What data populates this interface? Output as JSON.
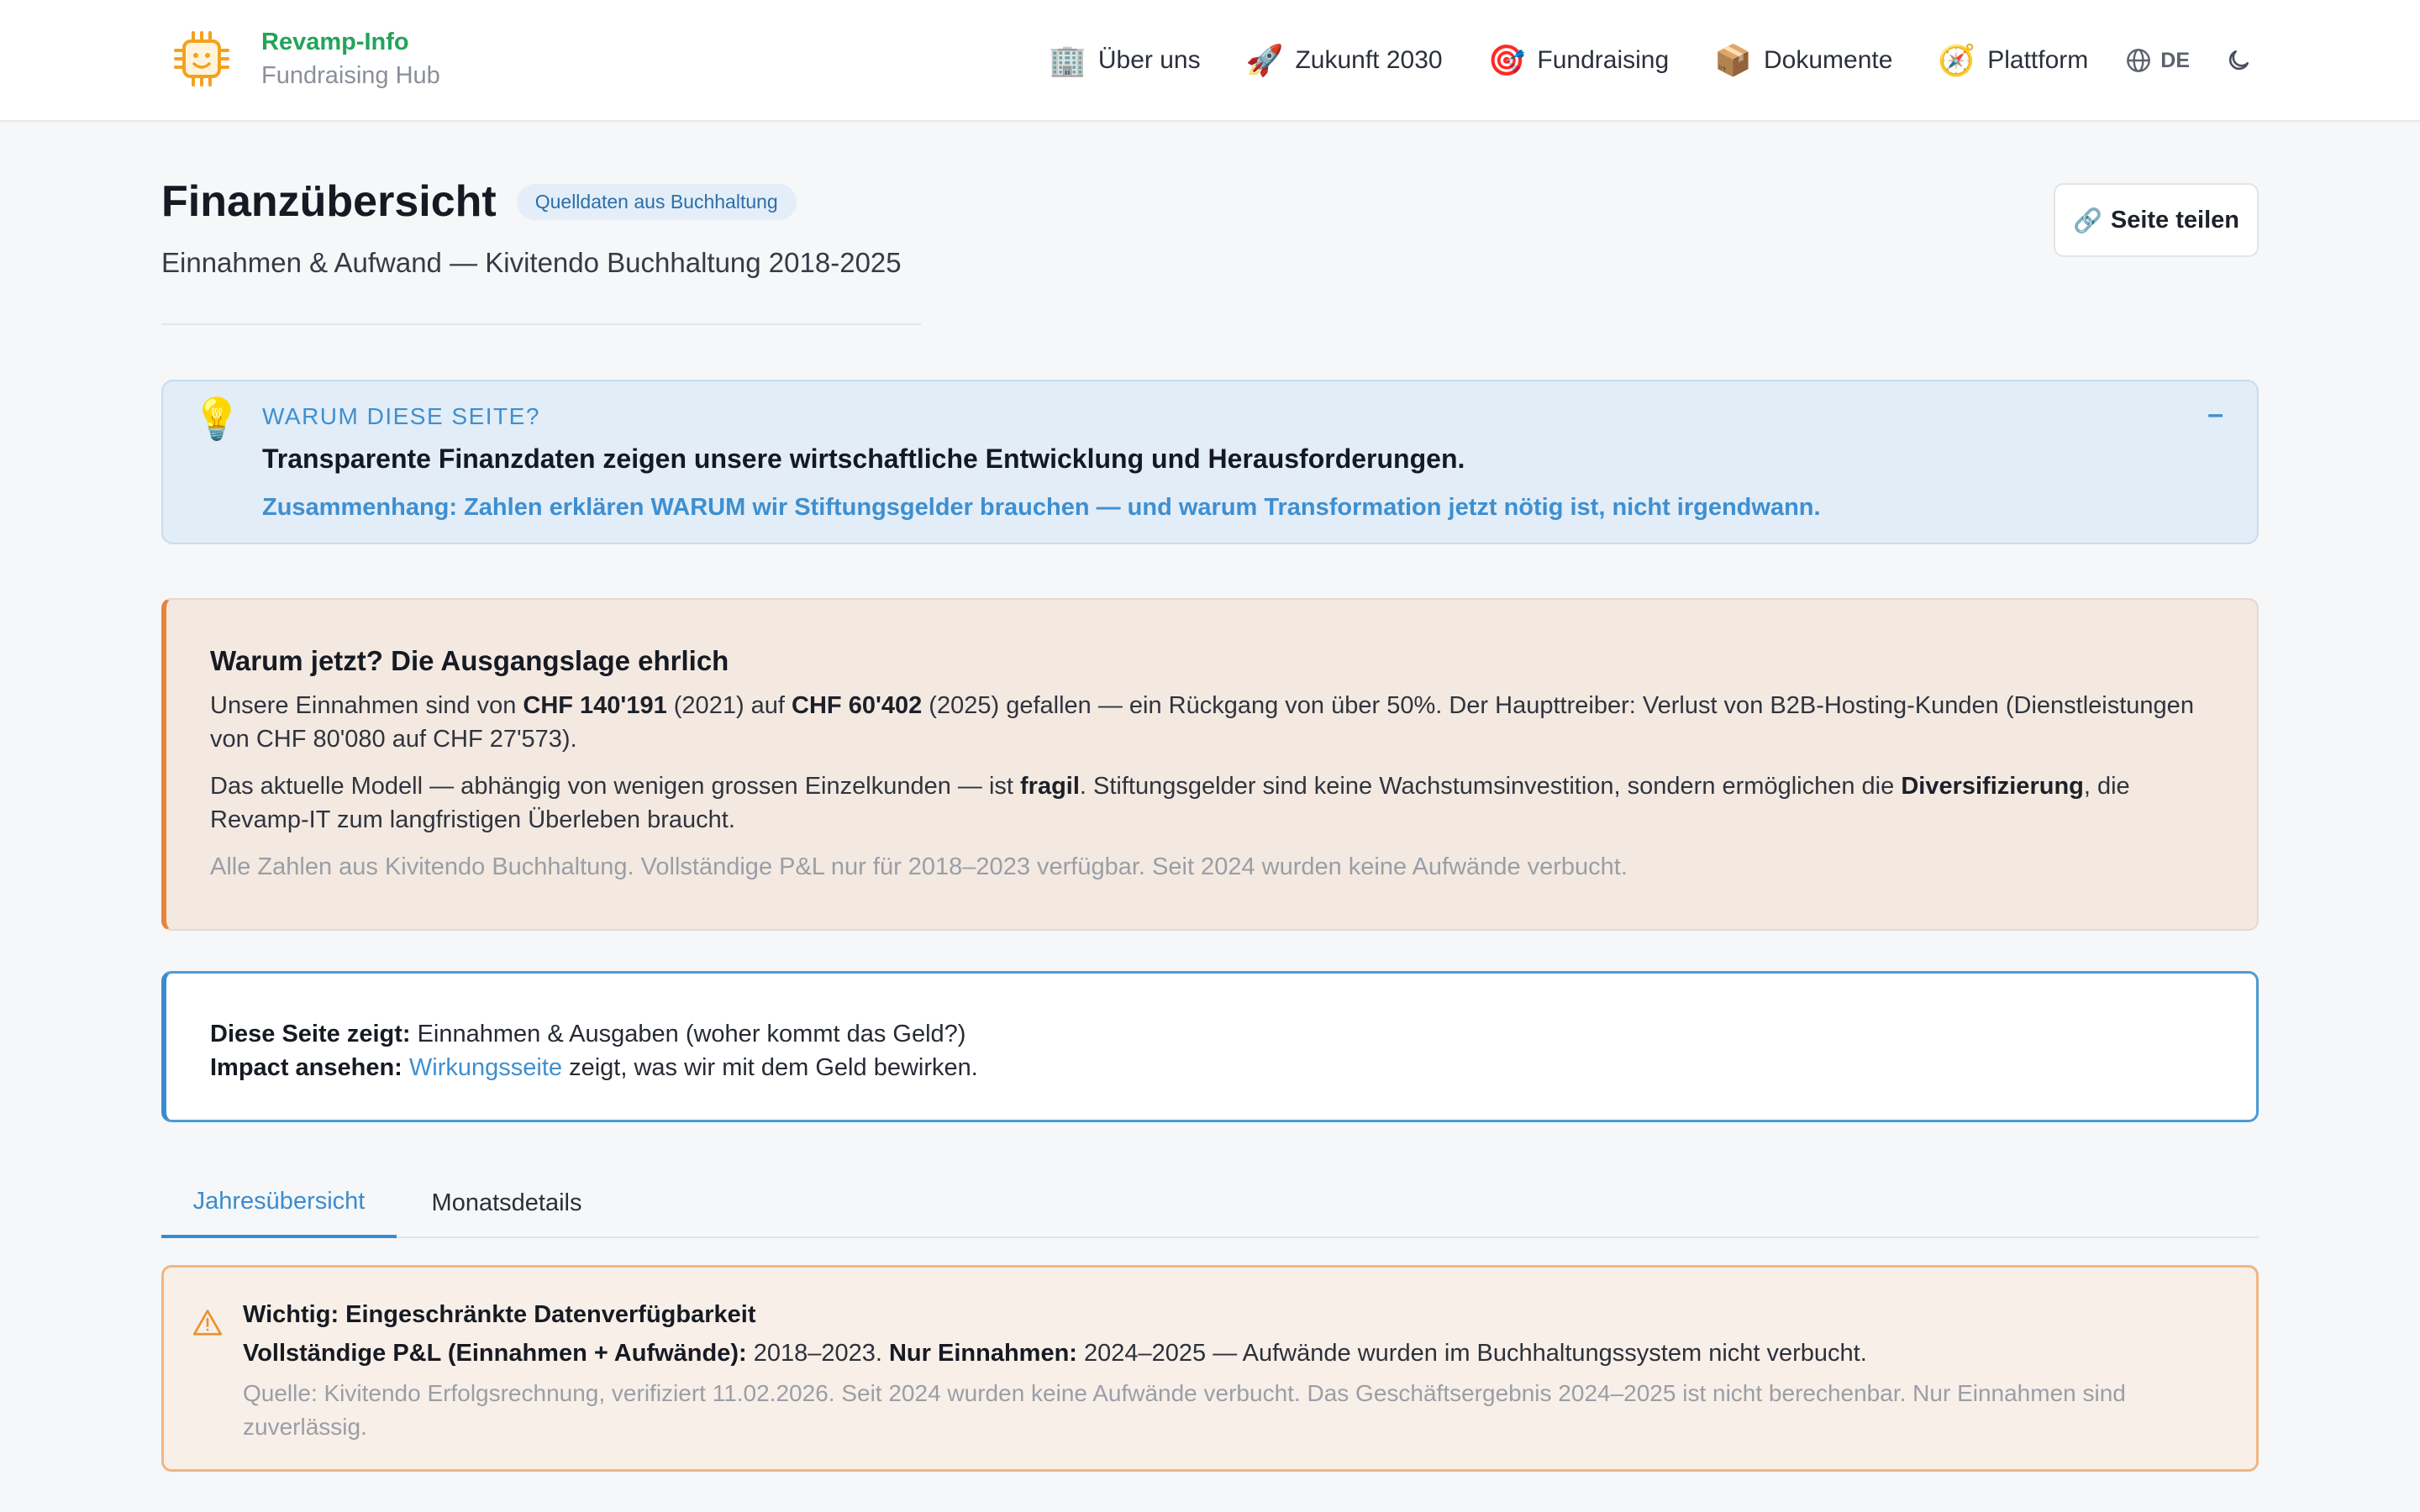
{
  "header": {
    "brand_name": "Revamp-Info",
    "brand_sub": "Fundraising Hub",
    "nav": [
      {
        "icon": "🏢",
        "label": "Über uns"
      },
      {
        "icon": "🚀",
        "label": "Zukunft 2030"
      },
      {
        "icon": "🎯",
        "label": "Fundraising"
      },
      {
        "icon": "📦",
        "label": "Dokumente"
      },
      {
        "icon": "🧭",
        "label": "Plattform"
      }
    ],
    "language": "DE"
  },
  "title": {
    "heading": "Finanzübersicht",
    "badge": "Quelldaten aus Buchhaltung",
    "subtitle": "Einnahmen & Aufwand — Kivitendo Buchhaltung 2018-2025",
    "share_label": "Seite teilen"
  },
  "why": {
    "label": "WARUM DIESE SEITE?",
    "headline": "Transparente Finanzdaten zeigen unsere wirtschaftliche Entwicklung und Herausforderungen.",
    "context": "Zusammenhang: Zahlen erklären WARUM wir Stiftungsgelder brauchen — und warum Transformation jetzt nötig ist, nicht irgendwann.",
    "collapse": "–"
  },
  "story": {
    "title": "Warum jetzt? Die Ausgangslage ehrlich",
    "p1_a": "Unsere Einnahmen sind von ",
    "p1_b": "CHF 140'191",
    "p1_c": " (2021) auf ",
    "p1_d": "CHF 60'402",
    "p1_e": " (2025) gefallen — ein Rückgang von über 50%. Der Haupttreiber: Verlust von B2B-Hosting-Kunden (Dienstleistungen von CHF 80'080 auf CHF 27'573).",
    "p2_a": "Das aktuelle Modell — abhängig von wenigen grossen Einzelkunden — ist ",
    "p2_b": "fragil",
    "p2_c": ". Stiftungsgelder sind keine Wachstumsinvestition, sondern ermöglichen die ",
    "p2_d": "Diversifizierung",
    "p2_e": ", die Revamp-IT zum langfristigen Überleben braucht.",
    "note": "Alle Zahlen aus Kivitendo Buchhaltung. Vollständige P&L nur für 2018–2023 verfügbar. Seit 2024 wurden keine Aufwände verbucht."
  },
  "scope": {
    "l1_label": "Diese Seite zeigt:",
    "l1_text": " Einnahmen & Ausgaben (woher kommt das Geld?)",
    "l2_label": "Impact ansehen:",
    "l2_link": "Wirkungsseite",
    "l2_text": " zeigt, was wir mit dem Geld bewirken."
  },
  "tabs": [
    "Jahresübersicht",
    "Monatsdetails"
  ],
  "warning": {
    "title": "Wichtig: Eingeschränkte Datenverfügbarkeit",
    "l_a": "Vollständige P&L (Einnahmen + Aufwände):",
    "l_b": " 2018–2023. ",
    "l_c": "Nur Einnahmen:",
    "l_d": " 2024–2025 — Aufwände wurden im Buchhaltungssystem nicht verbucht.",
    "source": "Quelle: Kivitendo Erfolgsrechnung, verifiziert 11.02.2026. Seit 2024 wurden keine Aufwände verbucht. Das Geschäftsergebnis 2024–2025 ist nicht berechenbar. Nur Einnahmen sind zuverlässig."
  },
  "colors": {
    "brand_green": "#22a45a",
    "accent_blue": "#3e8fd0",
    "accent_orange": "#e8843b"
  }
}
